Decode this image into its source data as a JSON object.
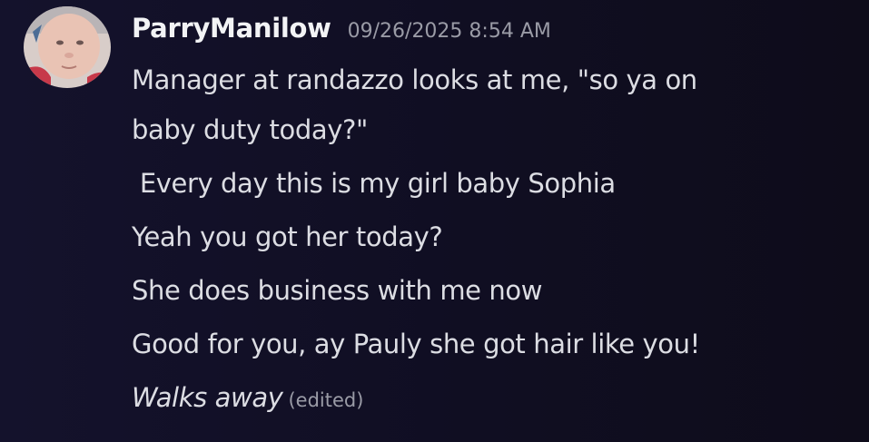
{
  "message": {
    "username": "ParryManilow",
    "timestamp": "09/26/2025 8:54 AM",
    "lines": [
      "Manager at randazzo looks at me, \"so ya on",
      "baby duty today?\"",
      " Every day this is my girl baby Sophia",
      "Yeah you got her today?",
      "She does business with me now",
      "Good for you, ay Pauly she got hair like you!"
    ],
    "action_text": "Walks away",
    "edited_label": "(edited)"
  },
  "colors": {
    "background": "#12102a",
    "username": "#f2f3f5",
    "text": "#dcdde3",
    "muted": "#9a9ba6"
  }
}
